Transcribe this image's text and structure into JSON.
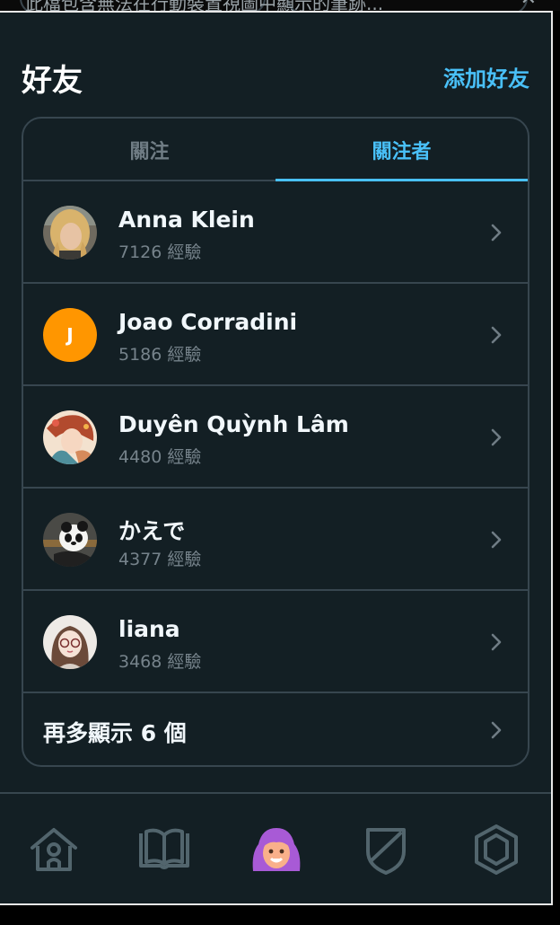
{
  "banner": {
    "text": "此檔包含無法在行動裝置視圖中顯示的筆跡..."
  },
  "header": {
    "title": "好友",
    "add_friend": "添加好友"
  },
  "tabs": {
    "following": "關注",
    "followers": "關注者",
    "active": "followers"
  },
  "followers": [
    {
      "name": "Anna Klein",
      "xp": "7126 經驗",
      "avatar": "photo-woman-blonde"
    },
    {
      "name": "Joao Corradini",
      "xp": "5186 經驗",
      "avatar": "initial",
      "initial": "J",
      "avatar_color": "#ff9600"
    },
    {
      "name": "Duyên Quỳnh Lâm",
      "xp": "4480 經驗",
      "avatar": "anime-girl-illustration"
    },
    {
      "name": "かえで",
      "xp": "4377 經驗",
      "avatar": "panda-photo"
    },
    {
      "name": "liana",
      "xp": "3468 經驗",
      "avatar": "illustrated-girl-glasses"
    }
  ],
  "show_more": {
    "label": "再多顯示 6 個"
  },
  "bottom_nav": {
    "items": [
      "home-icon",
      "book-icon",
      "profile-icon",
      "shield-icon",
      "hexagon-icon"
    ],
    "active": "profile-icon"
  },
  "colors": {
    "background": "#131f24",
    "border": "#37464f",
    "accent": "#49c0f8",
    "muted": "#76838b"
  }
}
